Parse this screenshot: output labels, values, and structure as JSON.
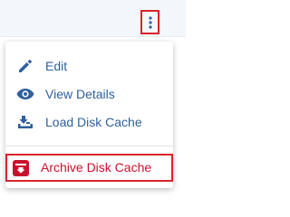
{
  "menu": {
    "items": [
      {
        "label": "Edit",
        "icon": "pencil-icon"
      },
      {
        "label": "View Details",
        "icon": "eye-icon"
      },
      {
        "label": "Load Disk Cache",
        "icon": "load-disk-cache-icon"
      },
      {
        "label": "Archive Disk Cache",
        "icon": "archive-icon"
      }
    ]
  },
  "colors": {
    "accent": "#2f5f9e",
    "danger": "#c8102e",
    "highlight_border": "#d9232c"
  }
}
